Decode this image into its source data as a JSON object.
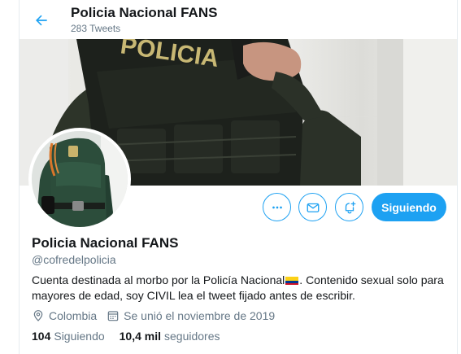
{
  "header": {
    "title": "Policia Nacional FANS",
    "tweet_count": "283 Tweets"
  },
  "banner": {
    "vest_text": "POLICIA"
  },
  "actions": {
    "more_icon": "more-dots-icon",
    "message_icon": "envelope-icon",
    "notify_icon": "bell-plus-icon",
    "follow_label": "Siguiendo"
  },
  "profile": {
    "name": "Policia Nacional FANS",
    "handle": "@cofredelpolicia",
    "bio_part1": "Cuenta destinada al morbo por la Policía Nacional",
    "bio_flag": "colombia-flag-emoji",
    "bio_part2": ". Contenido sexual solo para mayores de edad, soy CIVIL lea el tweet fijado antes de escribir.",
    "location": "Colombia",
    "joined": "Se unió el noviembre de 2019"
  },
  "stats": {
    "following_count": "104",
    "following_label": "Siguiendo",
    "followers_count": "10,4 mil",
    "followers_label": "seguidores"
  },
  "colors": {
    "accent": "#1da1f2",
    "muted": "#657786",
    "text": "#14171a",
    "flag_yellow": "#fcd116",
    "flag_blue": "#003893",
    "flag_red": "#ce1126"
  }
}
